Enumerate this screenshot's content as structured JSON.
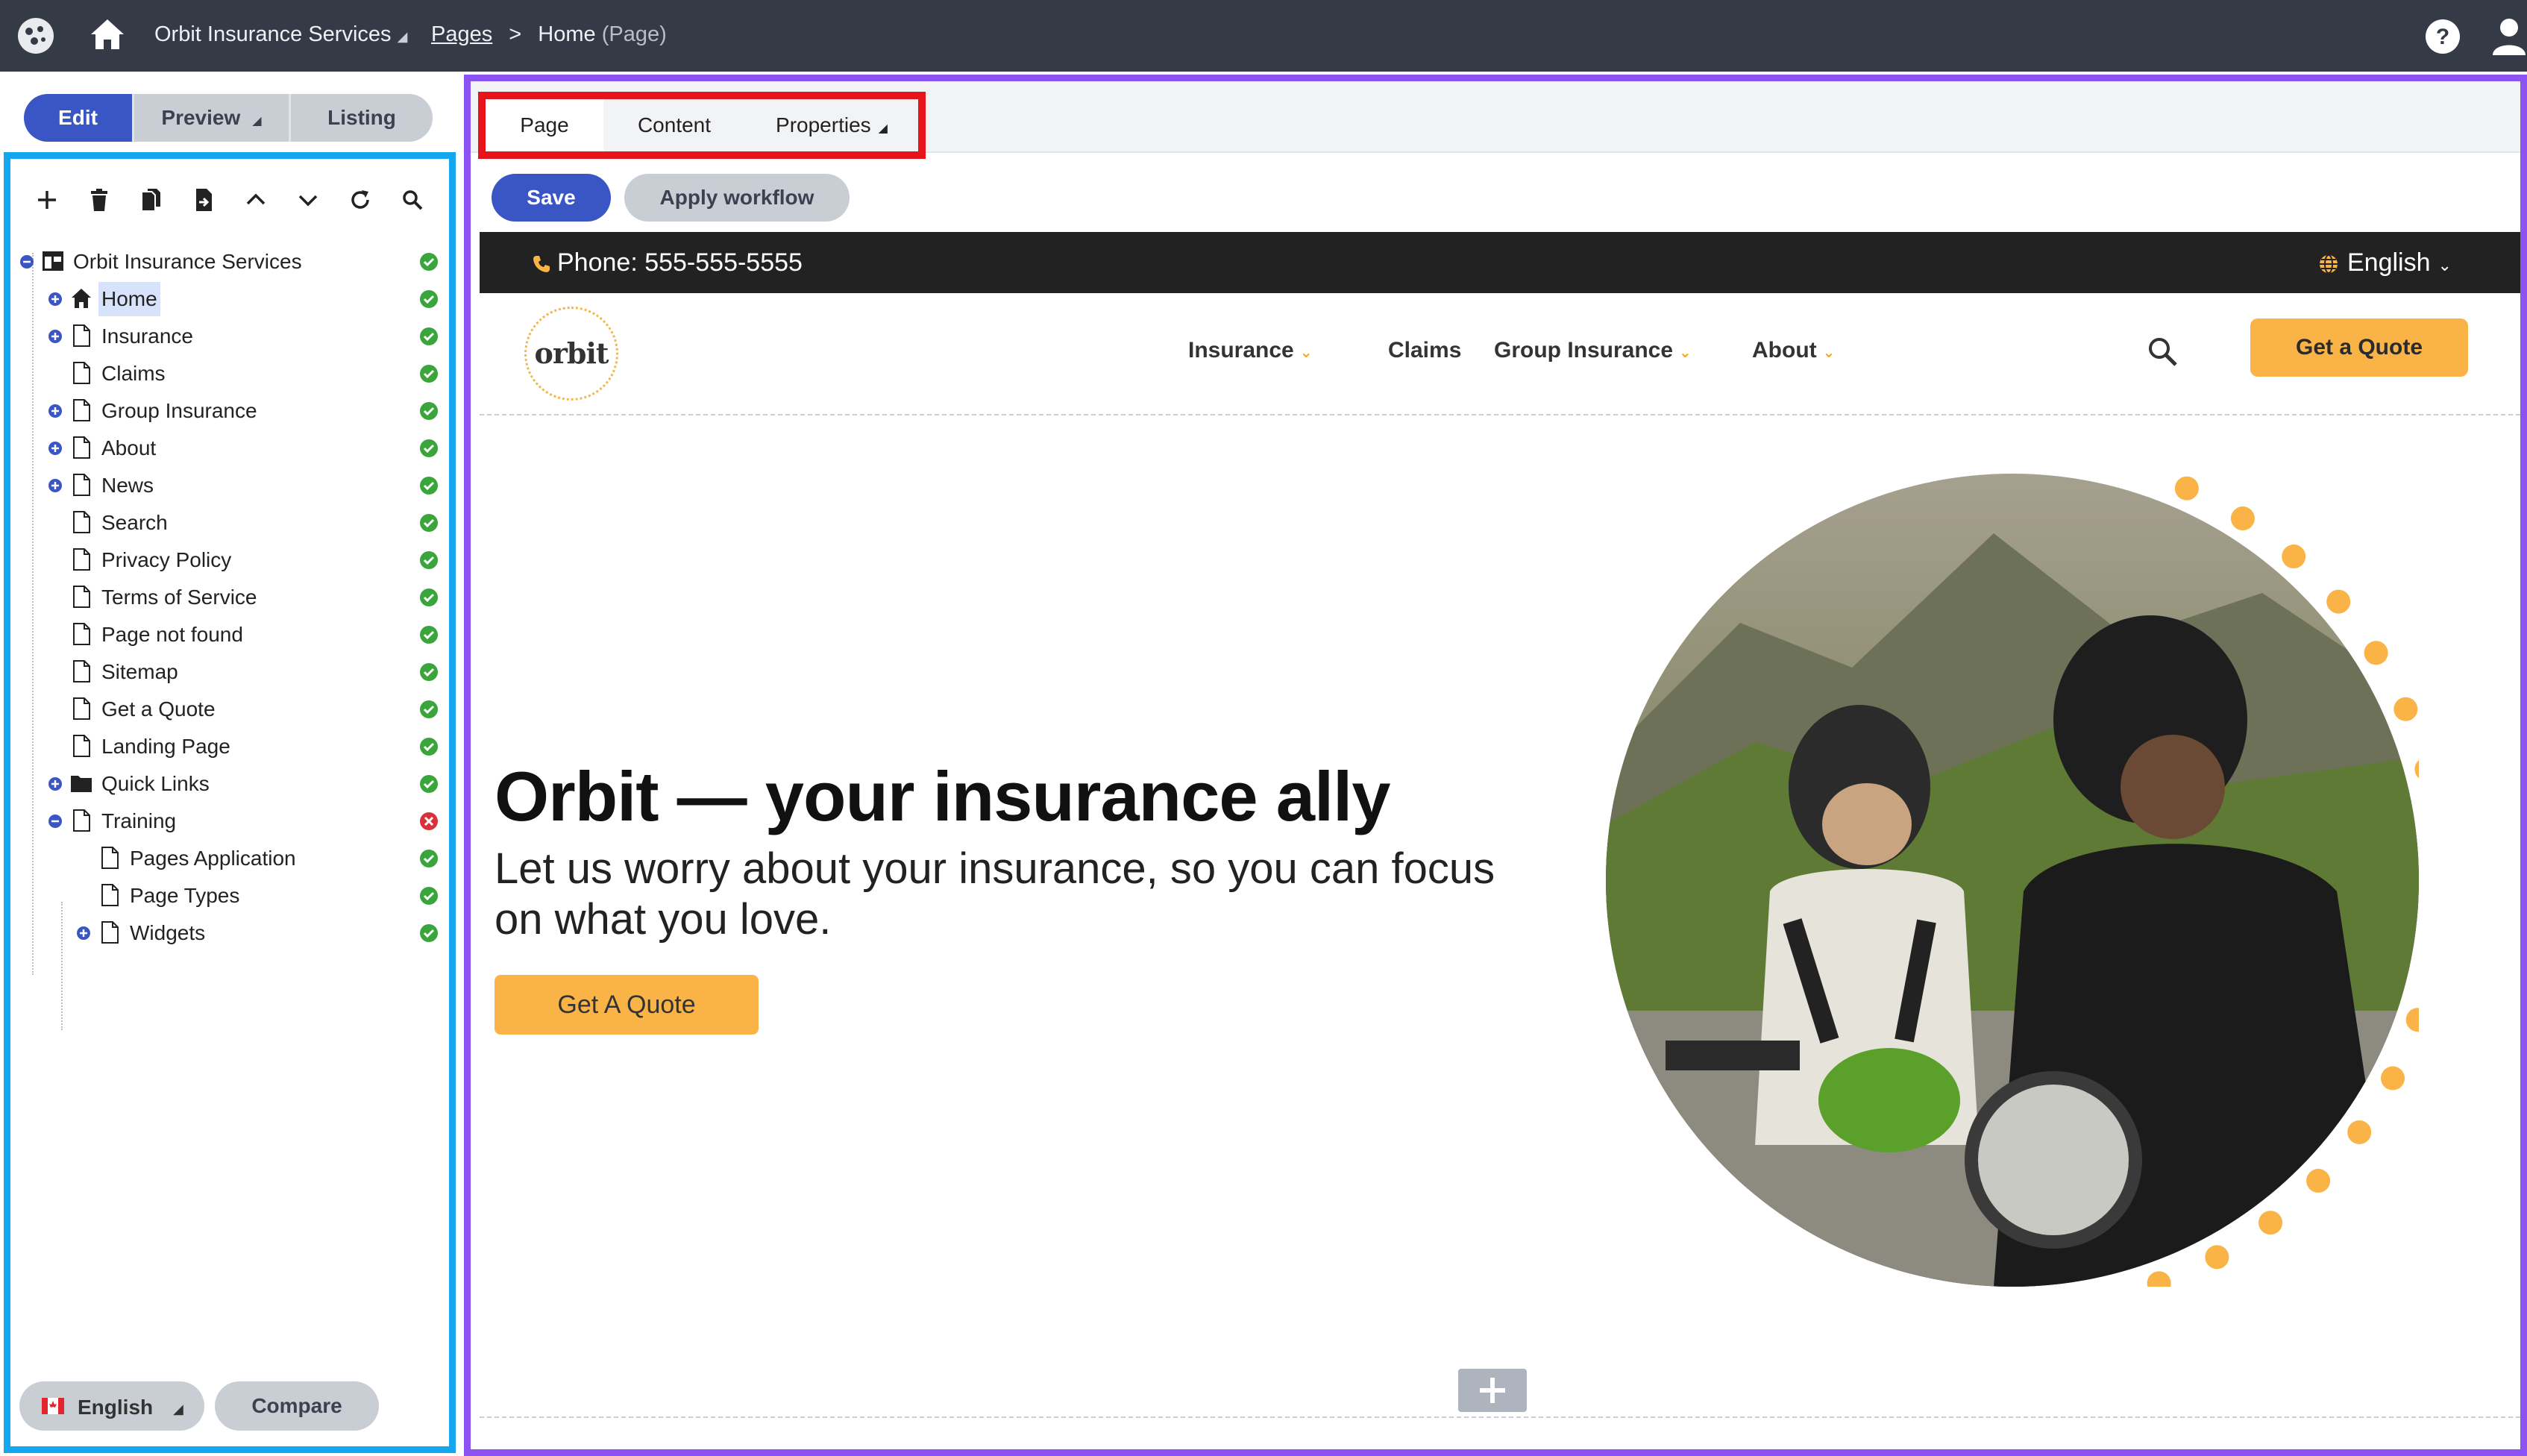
{
  "topbar": {
    "site_name": "Orbit Insurance Services",
    "breadcrumb_pages": "Pages",
    "breadcrumb_separator": ">",
    "breadcrumb_current": "Home",
    "breadcrumb_current_type": "(Page)",
    "bg_color": "#343a46",
    "icons": [
      "app-logo-icon",
      "home-icon",
      "help-icon",
      "user-icon"
    ]
  },
  "mode_tabs": [
    {
      "label": "Edit",
      "active": true
    },
    {
      "label": "Preview",
      "active": false,
      "has_menu": true
    },
    {
      "label": "Listing",
      "active": false
    }
  ],
  "tree_toolbar": [
    "add-icon",
    "delete-icon",
    "copy-icon",
    "move-icon",
    "move-up-icon",
    "move-down-icon",
    "refresh-icon",
    "search-icon"
  ],
  "tree": [
    {
      "label": "Orbit Insurance Services",
      "level": 0,
      "icon": "site-icon",
      "expand": "collapse",
      "status": "published"
    },
    {
      "label": "Home",
      "level": 1,
      "icon": "home-icon",
      "expand": "expand",
      "status": "published",
      "selected": true
    },
    {
      "label": "Insurance",
      "level": 1,
      "icon": "page-icon",
      "expand": "expand",
      "status": "published"
    },
    {
      "label": "Claims",
      "level": 1,
      "icon": "page-icon",
      "expand": "none",
      "status": "published"
    },
    {
      "label": "Group Insurance",
      "level": 1,
      "icon": "page-icon",
      "expand": "expand",
      "status": "published"
    },
    {
      "label": "About",
      "level": 1,
      "icon": "page-icon",
      "expand": "expand",
      "status": "published"
    },
    {
      "label": "News",
      "level": 1,
      "icon": "page-icon",
      "expand": "expand",
      "status": "published"
    },
    {
      "label": "Search",
      "level": 1,
      "icon": "page-icon",
      "expand": "none",
      "status": "published"
    },
    {
      "label": "Privacy Policy",
      "level": 1,
      "icon": "page-icon",
      "expand": "none",
      "status": "published"
    },
    {
      "label": "Terms of Service",
      "level": 1,
      "icon": "page-icon",
      "expand": "none",
      "status": "published"
    },
    {
      "label": "Page not found",
      "level": 1,
      "icon": "page-icon",
      "expand": "none",
      "status": "published"
    },
    {
      "label": "Sitemap",
      "level": 1,
      "icon": "page-icon",
      "expand": "none",
      "status": "published"
    },
    {
      "label": "Get a Quote",
      "level": 1,
      "icon": "page-icon",
      "expand": "none",
      "status": "published"
    },
    {
      "label": "Landing Page",
      "level": 1,
      "icon": "page-icon",
      "expand": "none",
      "status": "published"
    },
    {
      "label": "Quick Links",
      "level": 1,
      "icon": "folder-icon",
      "expand": "expand",
      "status": "published"
    },
    {
      "label": "Training",
      "level": 1,
      "icon": "page-icon",
      "expand": "collapse",
      "status": "unpublished"
    },
    {
      "label": "Pages Application",
      "level": 2,
      "icon": "page-icon",
      "expand": "none",
      "status": "published"
    },
    {
      "label": "Page Types",
      "level": 2,
      "icon": "page-icon",
      "expand": "none",
      "status": "published"
    },
    {
      "label": "Widgets",
      "level": 2,
      "icon": "page-icon",
      "expand": "expand",
      "status": "published"
    }
  ],
  "bottom": {
    "language": "English",
    "compare": "Compare"
  },
  "page_tabs": [
    {
      "label": "Page",
      "active": true
    },
    {
      "label": "Content",
      "active": false
    },
    {
      "label": "Properties",
      "active": false,
      "has_menu": true
    }
  ],
  "actions": {
    "save": "Save",
    "apply_workflow": "Apply workflow"
  },
  "site": {
    "phone": "Phone: 555-555-5555",
    "language": "English",
    "logo_text": "orbit",
    "nav": [
      {
        "label": "Insurance",
        "dropdown": true
      },
      {
        "label": "Claims",
        "dropdown": false
      },
      {
        "label": "Group Insurance",
        "dropdown": true
      },
      {
        "label": "About",
        "dropdown": true
      }
    ],
    "quote_button": "Get a Quote",
    "hero_title": "Orbit — your insurance ally",
    "hero_subtitle": "Let us worry about your insurance, so you can focus on what you love.",
    "hero_button": "Get A Quote",
    "accent_color": "#f9b347"
  },
  "colors": {
    "primary": "#3a56c5",
    "tree_frame": "#12a7ee",
    "page_frame": "#8b54f2",
    "tabs_highlight": "#e8141c",
    "published": "#3aa53a",
    "unpublished": "#d9303a"
  }
}
